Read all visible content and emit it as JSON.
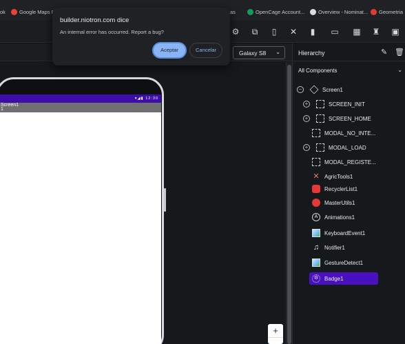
{
  "bookmarks": [
    {
      "label": "ok",
      "color": "#3a7bd5"
    },
    {
      "label": "Google Maps P",
      "color": "#ea4335"
    },
    {
      "label": "as",
      "color": "#888888"
    },
    {
      "label": "OpenCage Account...",
      "color": "#0f9d58"
    },
    {
      "label": "Overview - Nominat...",
      "color": "#dddddd"
    },
    {
      "label": "Geometria",
      "color": "#e53935"
    }
  ],
  "dialog": {
    "title": "builder.niotron.com dice",
    "message": "An internal error has occurred. Report a bug?",
    "ok_label": "Aceptar",
    "cancel_label": "Cancelar"
  },
  "device": {
    "selected": "Galaxy S8"
  },
  "phone": {
    "status_time": "12:30",
    "title": "Screen1",
    "subtitle": "1"
  },
  "hierarchy": {
    "title": "Hierarchy",
    "filter": "All Components",
    "items": [
      {
        "label": "Screen1",
        "icon": "layers-icon"
      },
      {
        "label": "SCREEN_INIT",
        "icon": "arrangement-icon"
      },
      {
        "label": "SCREEN_HOME",
        "icon": "arrangement-icon"
      },
      {
        "label": "MODAL_NO_INTE...",
        "icon": "arrangement-icon"
      },
      {
        "label": "MODAL_LOAD",
        "icon": "arrangement-icon"
      },
      {
        "label": "MODAL_REGISTE...",
        "icon": "arrangement-icon"
      },
      {
        "label": "AgricTools1",
        "icon": "tools-icon"
      },
      {
        "label": "RecyclerList1",
        "icon": "extension-icon"
      },
      {
        "label": "MasterUtils1",
        "icon": "extension-icon"
      },
      {
        "label": "Animations1",
        "icon": "animation-icon"
      },
      {
        "label": "KeyboardEvent1",
        "icon": "image-icon"
      },
      {
        "label": "Notifier1",
        "icon": "bell-icon"
      },
      {
        "label": "GestureDetect1",
        "icon": "image-icon"
      },
      {
        "label": "Badge1",
        "icon": "gear-icon"
      }
    ]
  },
  "zoom": {
    "plus": "+"
  },
  "colors": {
    "accent": "#4a10c0",
    "statusbar": "#3c0da8",
    "dialog_button": "#8ab4f8"
  }
}
